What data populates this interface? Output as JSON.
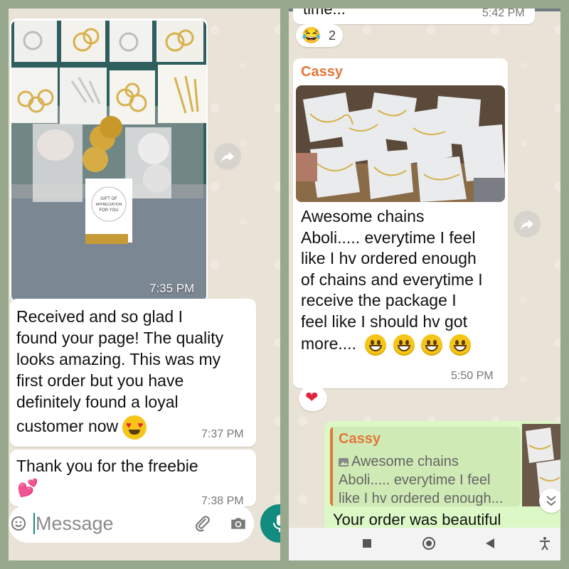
{
  "left_chat": {
    "photo_time": "7:35 PM",
    "photo_card_text": "GIFT OF APPRECIATION FOR YOU",
    "msg1": {
      "lines": [
        "Received and so glad I",
        "found your page! The quality",
        "looks amazing. This was my",
        "first order but you have",
        "definitely found a loyal",
        "customer now"
      ],
      "emoji": "heart-eyes",
      "time": "7:37 PM"
    },
    "msg2": {
      "text": "Thank you for the freebie",
      "emoji": "two-hearts",
      "time": "7:38 PM"
    },
    "input_placeholder": "Message"
  },
  "right_chat": {
    "top_snippet_text": "time...",
    "top_snippet_time": "5:42 PM",
    "reaction": {
      "emoji": "laughing-tears",
      "count": "2"
    },
    "msg": {
      "sender": "Cassy",
      "lines": [
        "Awesome chains",
        "Aboli..... everytime I feel",
        "like I hv ordered enough",
        "of chains and everytime I",
        "receive the package I",
        "feel like I should hv got",
        "more...."
      ],
      "emojis": [
        "grinning",
        "grinning",
        "grinning",
        "grinning"
      ],
      "time": "5:50 PM",
      "reaction": "heart"
    },
    "reply": {
      "quote_sender": "Cassy",
      "quote_line1": "Awesome chains",
      "quote_line2": "Aboli..... everytime I feel",
      "quote_line3": "like I hv ordered enough...",
      "text": "Your order was beautiful"
    }
  },
  "colors": {
    "sender": "#e3763a",
    "outgoing_bubble": "#dcf8c6",
    "mic_button": "#128c7e",
    "frame": "#98a88c"
  }
}
